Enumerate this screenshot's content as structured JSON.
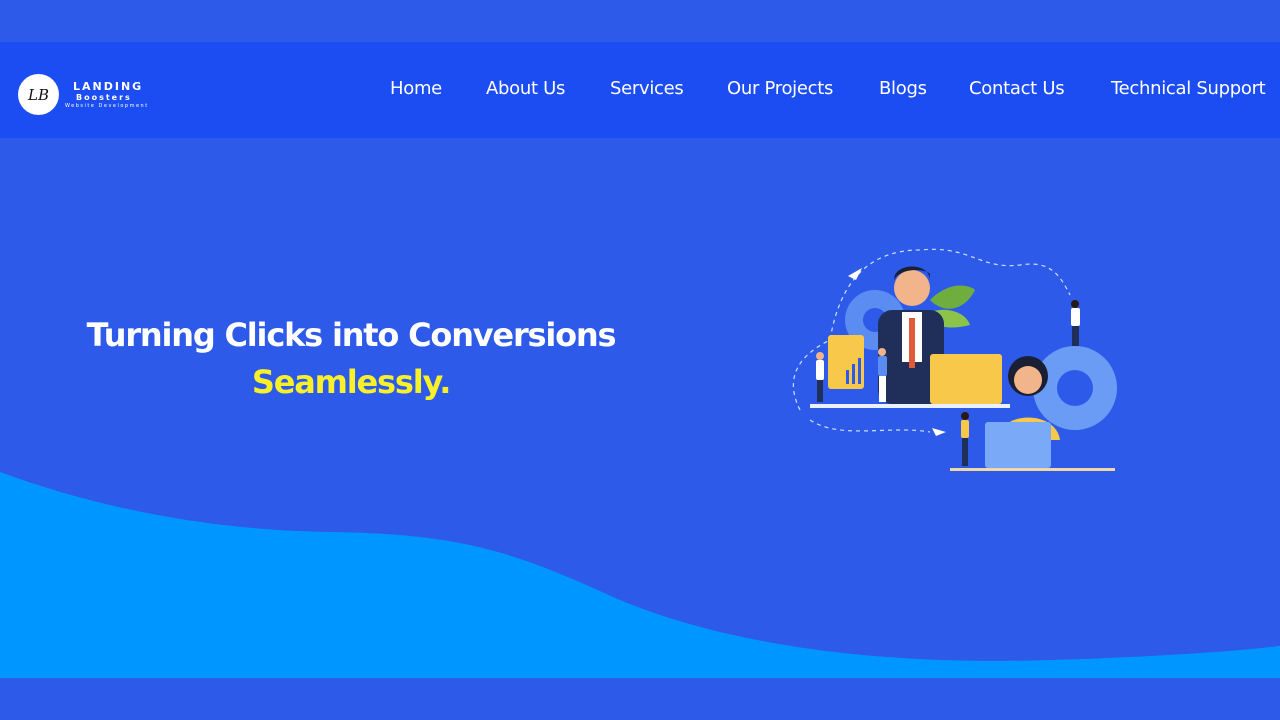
{
  "brand": {
    "monogram": "LB",
    "name": "LANDING",
    "name_line2": "Boosters",
    "tagline": "Website Development"
  },
  "nav": {
    "items": [
      {
        "label": "Home"
      },
      {
        "label": "About Us"
      },
      {
        "label": "Services"
      },
      {
        "label": "Our Projects"
      },
      {
        "label": "Blogs"
      },
      {
        "label": "Contact Us"
      },
      {
        "label": "Technical Support"
      }
    ]
  },
  "hero": {
    "title": "Turning Clicks into Conversions",
    "accent": "Seamlessly."
  },
  "colors": {
    "background": "#2e5ae9",
    "header": "#1b4df2",
    "wave": "#0096ff",
    "accent_text": "#f8f12a"
  }
}
